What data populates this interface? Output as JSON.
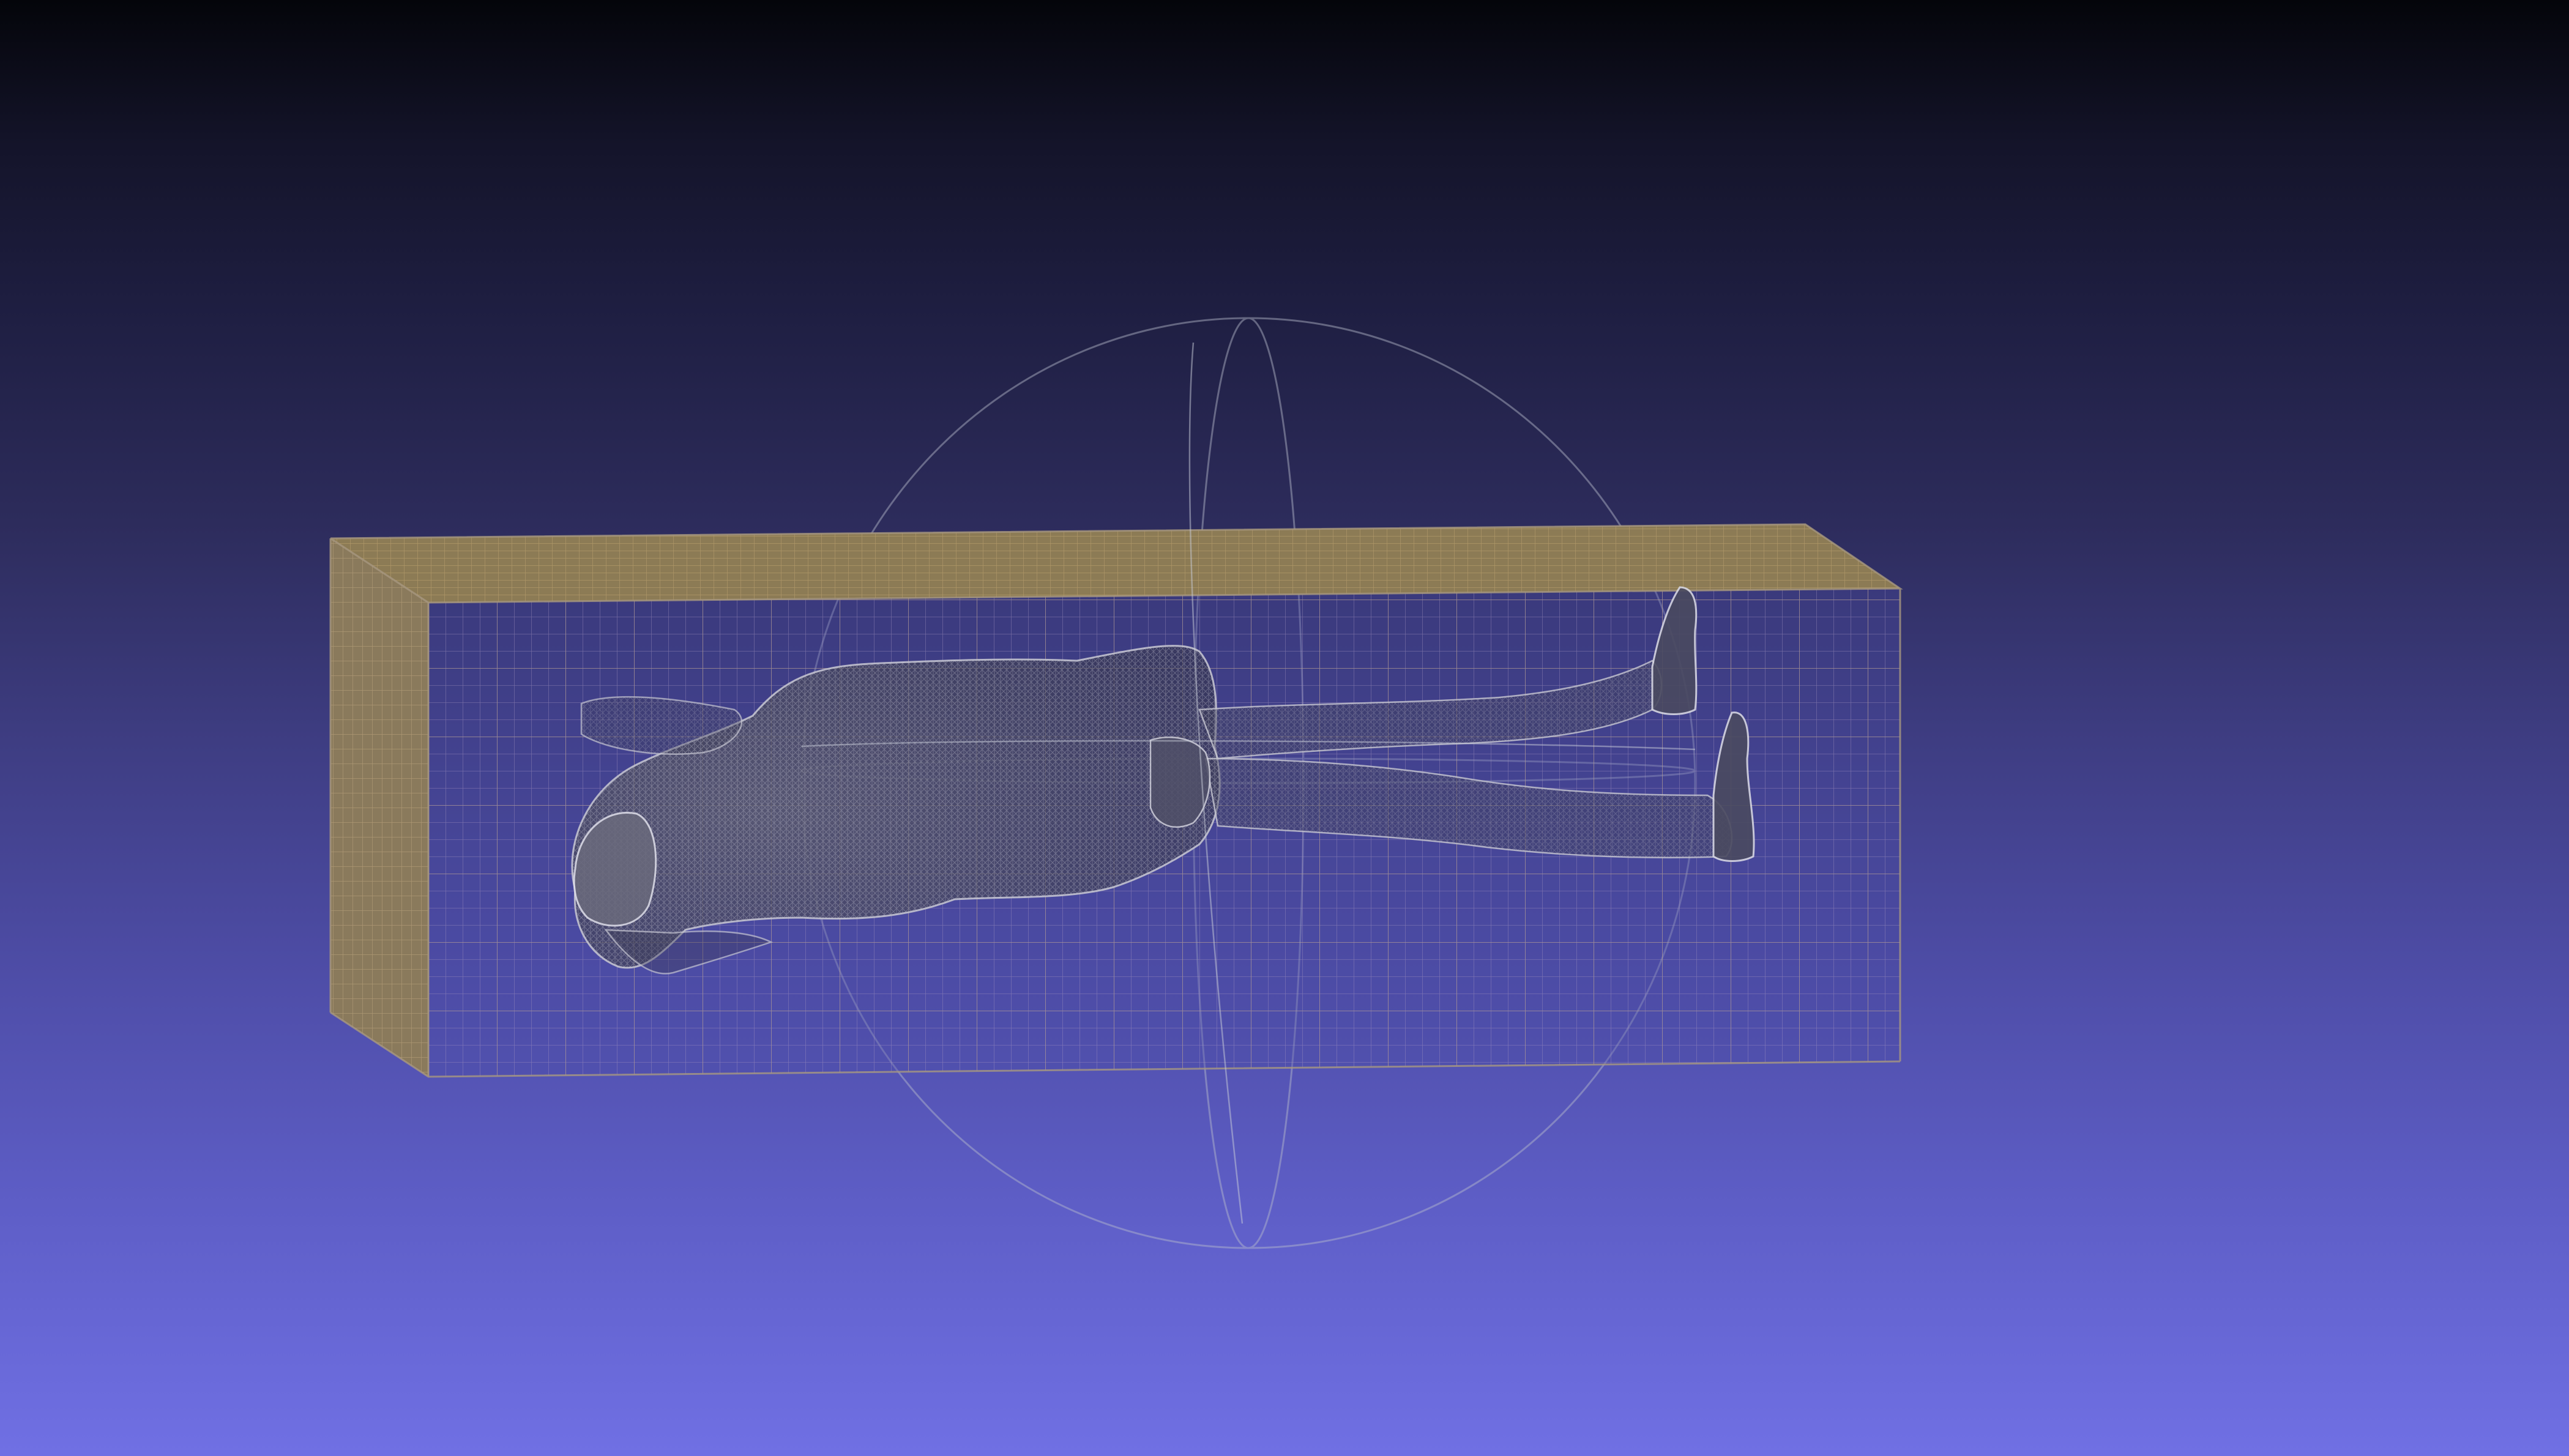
{
  "viewport": {
    "background_top": "#04050a",
    "background_bottom": "#7070e4"
  },
  "scene": {
    "trackball_color": "#b8bccc",
    "box_top_face_color": "#8c7b55",
    "box_side_face_color": "#8a7a5c",
    "box_grid_color": "#a48c70",
    "box_front_grid_color": "#9b8fc0",
    "mesh_color": "#c4c4cc",
    "mesh_fill": "#3e3e52"
  }
}
